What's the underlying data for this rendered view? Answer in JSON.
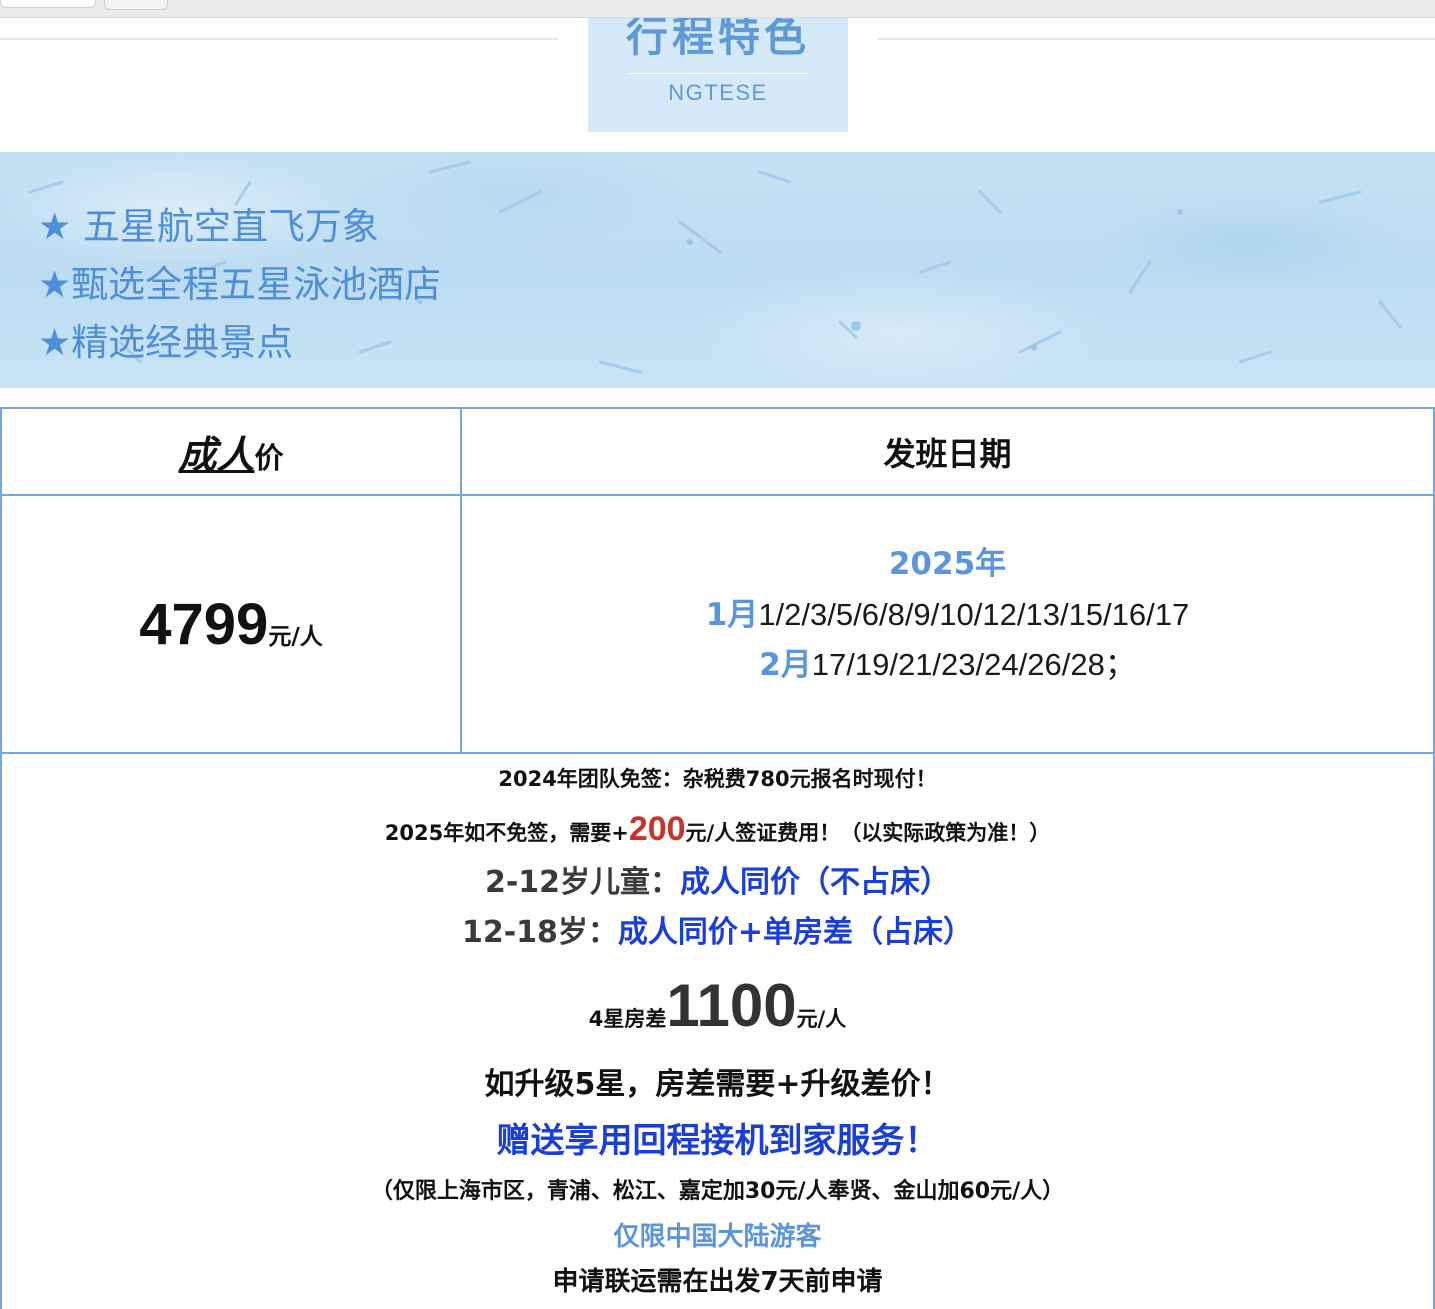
{
  "section": {
    "title_cn": "行程特色",
    "title_en": "NGTESE"
  },
  "features": [
    "★ 五星航空直飞万象",
    "★甄选全程五星泳池酒店",
    "★精选经典景点"
  ],
  "table": {
    "header_price_big": "成人",
    "header_price_small": "价",
    "header_dates": "发班日期",
    "price_value": "4799",
    "price_unit": "元/人",
    "year": "2025年",
    "rows": [
      {
        "month": "1月",
        "days": "1/2/3/5/6/8/9/10/12/13/15/16/17"
      },
      {
        "month": "2月",
        "days": "17/19/21/23/24/26/28；"
      }
    ]
  },
  "notes": {
    "visa_line": "2024年团队免签：杂税费780元报名时现付！",
    "visa_2025_before": "2025年如不免签，需要+",
    "visa_2025_amount": "200",
    "visa_2025_after": "元/人签证费用！（以实际政策为准！）",
    "child_label": "2-12岁儿童：",
    "child_value": "成人同价（不占床）",
    "teen_label": "12-18岁：",
    "teen_value": "成人同价+单房差（占床）",
    "room_prefix": "4星房差",
    "room_amount": "1100",
    "room_unit": "元/人",
    "upgrade": "如升级5星，房差需要+升级差价！",
    "gift": "赠送享用回程接机到家服务！",
    "gift_note": "（仅限上海市区，青浦、松江、嘉定加30元/人奉贤、金山加60元/人）",
    "mainland_only": "仅限中国大陆游客",
    "transfer_note": "申请联运需在出发7天前申请"
  },
  "colors": {
    "accent_blue": "#5b96dc",
    "deep_blue": "#1a3fd8",
    "red": "#c8342a",
    "border": "#73a6e2"
  }
}
